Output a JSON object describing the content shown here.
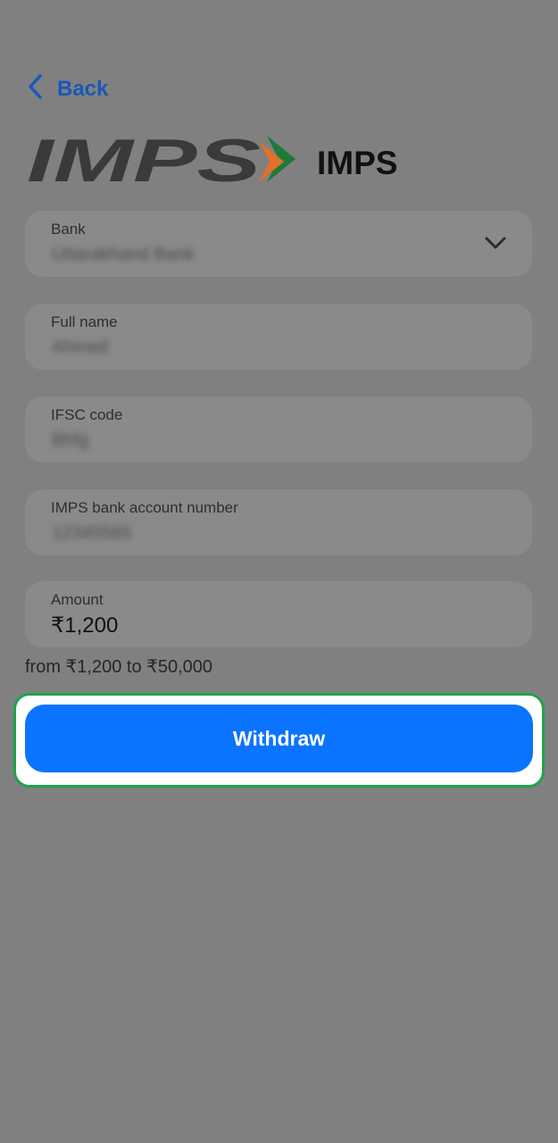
{
  "nav": {
    "back_label": "Back"
  },
  "brand": {
    "logo_text": "IMPS",
    "title": "IMPS"
  },
  "form": {
    "bank": {
      "label": "Bank",
      "value": "Uttarakhand Bank"
    },
    "full_name": {
      "label": "Full name",
      "value": "Ahmed"
    },
    "ifsc": {
      "label": "IFSC code",
      "value": "Bhfg"
    },
    "account": {
      "label": "IMPS bank account number",
      "value": "12345565"
    },
    "amount": {
      "label": "Amount",
      "value": "₹1,200"
    },
    "range_text": "from ₹1,200 to ₹50,000"
  },
  "actions": {
    "withdraw_label": "Withdraw"
  },
  "colors": {
    "overlay": "#808080",
    "link": "#1a57b8",
    "button": "#0a74ff",
    "highlight_border": "#1fa34a",
    "logo_orange": "#e0702a",
    "logo_green": "#1e7a3a",
    "logo_text": "#3a3a3a"
  },
  "icons": {
    "back": "chevron-left-icon",
    "dropdown": "chevron-down-icon"
  }
}
